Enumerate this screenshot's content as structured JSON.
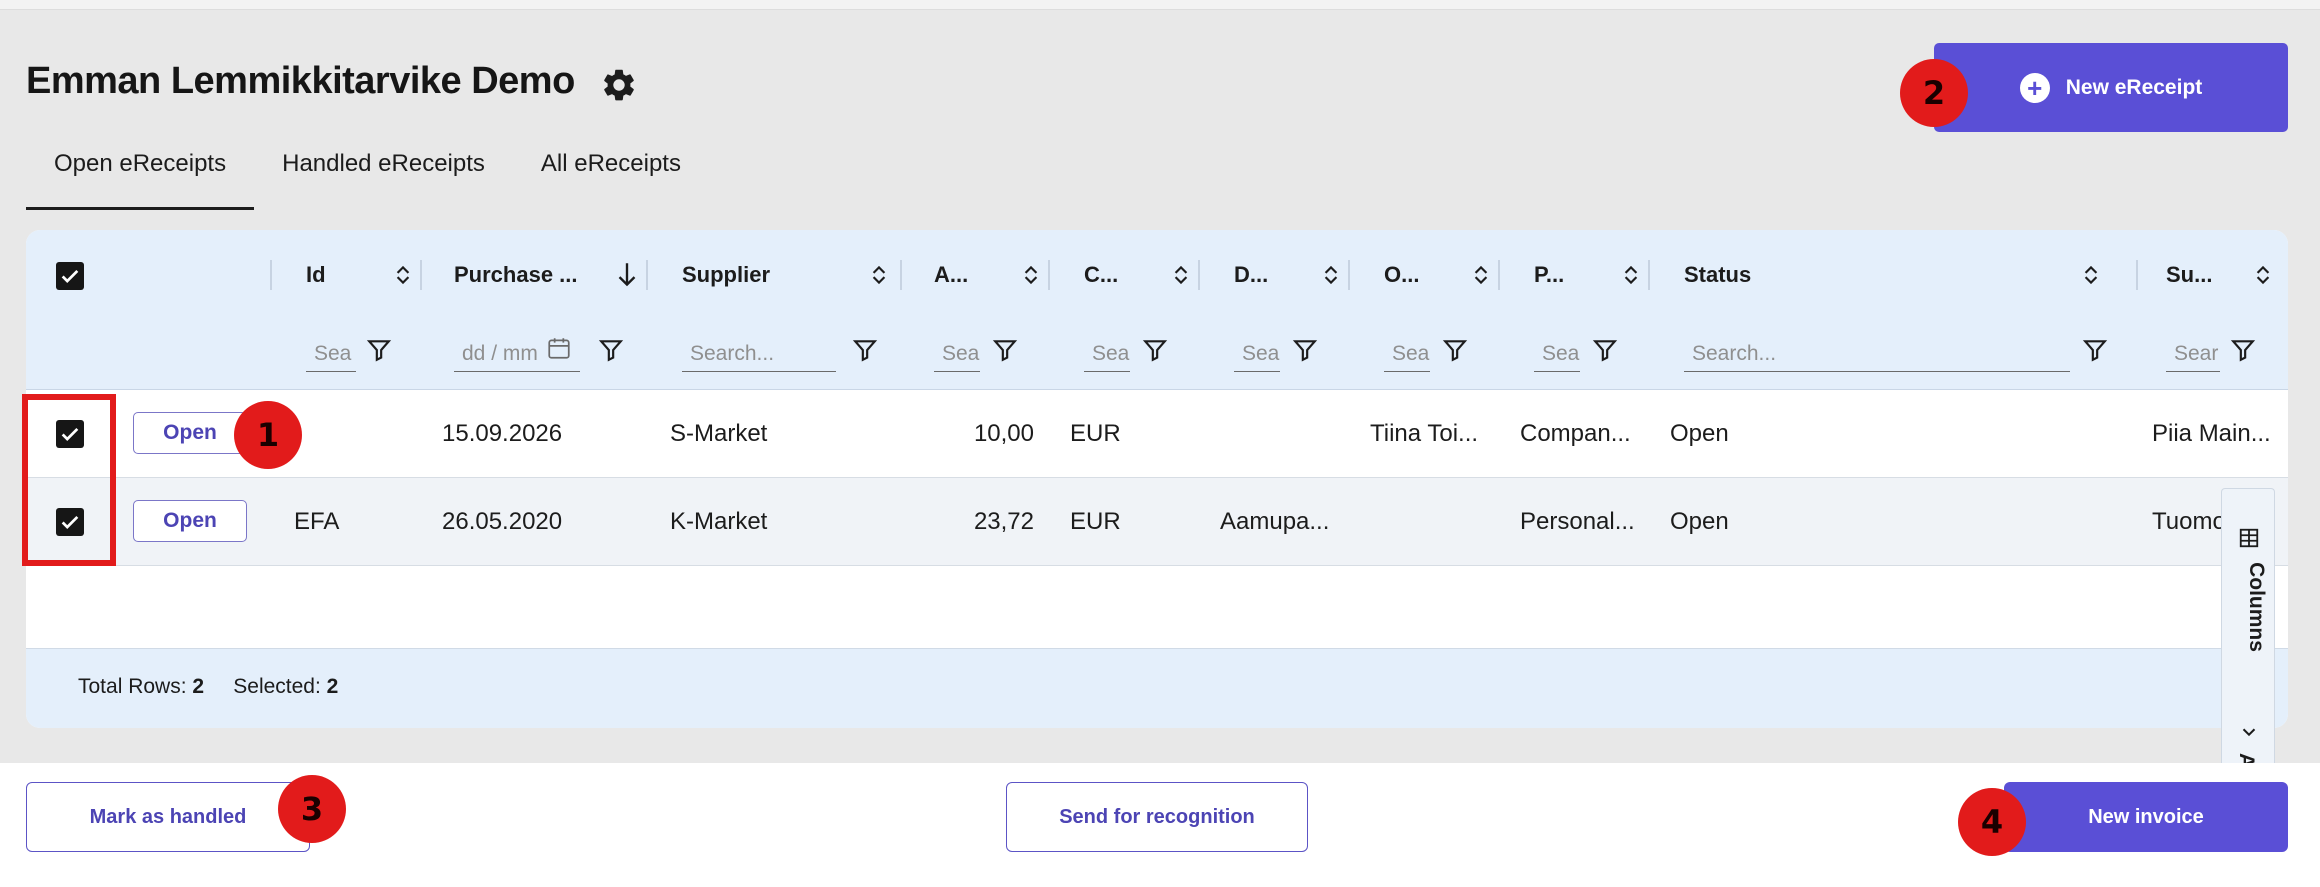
{
  "header": {
    "title": "Emman Lemmikkitarvike Demo",
    "new_button_label": "New eReceipt"
  },
  "tabs": [
    {
      "label": "Open eReceipts",
      "active": true
    },
    {
      "label": "Handled eReceipts",
      "active": false
    },
    {
      "label": "All eReceipts",
      "active": false
    }
  ],
  "table": {
    "columns": [
      "Id",
      "Purchase ...",
      "Supplier",
      "A...",
      "C...",
      "D...",
      "O...",
      "P...",
      "Status",
      "Su..."
    ],
    "filters": {
      "id": "Sea",
      "purchase": "dd / mm",
      "supplier": "Search...",
      "amount": "Sea",
      "currency": "Sea",
      "description": "Sea",
      "owner": "Sea",
      "payment": "Sea",
      "status": "Search...",
      "submitter": "Sear"
    },
    "rows": [
      {
        "action": "Open",
        "id": "",
        "date": "15.09.2026",
        "supplier": "S-Market",
        "amount": "10,00",
        "currency": "EUR",
        "description": "",
        "owner": "Tiina Toi...",
        "payment": "Compan...",
        "status": "Open",
        "submitter": "Piia Main..."
      },
      {
        "action": "Open",
        "id": "EFA",
        "date": "26.05.2020",
        "supplier": "K-Market",
        "amount": "23,72",
        "currency": "EUR",
        "description": "Aamupa...",
        "owner": "",
        "payment": "Personal...",
        "status": "Open",
        "submitter": "Tuomo"
      }
    ],
    "footer": {
      "total_label": "Total Rows:",
      "total_value": "2",
      "selected_label": "Selected:",
      "selected_value": "2"
    }
  },
  "side_panel": {
    "columns_label": "Columns",
    "advanced_label": "Ad"
  },
  "actions": {
    "mark_handled": "Mark as handled",
    "send_recognition": "Send for recognition",
    "new_invoice": "New invoice"
  },
  "markers": [
    "1",
    "2",
    "3",
    "4"
  ],
  "colors": {
    "accent": "#5a4fd6",
    "marker": "#e21b1b",
    "grid_header": "#e4effb"
  }
}
